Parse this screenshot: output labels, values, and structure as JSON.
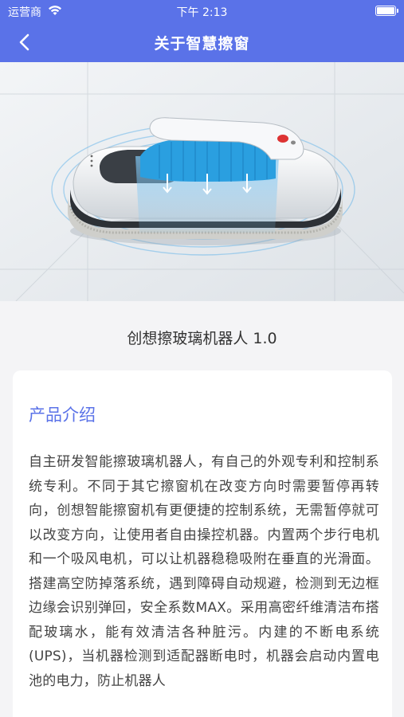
{
  "status_bar": {
    "carrier": "运营商",
    "time": "下午 2:13"
  },
  "nav": {
    "title": "关于智慧擦窗",
    "back_icon": "chevron-left-icon"
  },
  "product": {
    "name": "创想擦玻璃机器人 1.0"
  },
  "intro": {
    "heading": "产品介绍",
    "text": "自主研发智能擦玻璃机器人，有自己的外观专利和控制系统专利。不同于其它擦窗机在改变方向时需要暂停再转向，创想智能擦窗机有更便捷的控制系统，无需暂停就可以改变方向，让使用者自由操控机器。内置两个步行电机和一个吸风电机，可以让机器稳稳吸附在垂直的光滑面。搭建高空防掉落系统，遇到障碍自动规避，检测到无边框边缘会识别弹回，安全系数MAX。采用高密纤维清洁布搭配玻璃水，能有效清洁各种脏污。内建的不断电系统 (UPS)，当机器检测到适配器断电时，机器会启动内置电池的电力，防止机器人"
  },
  "colors": {
    "accent": "#5a72e8",
    "background": "#f4f4f6"
  }
}
